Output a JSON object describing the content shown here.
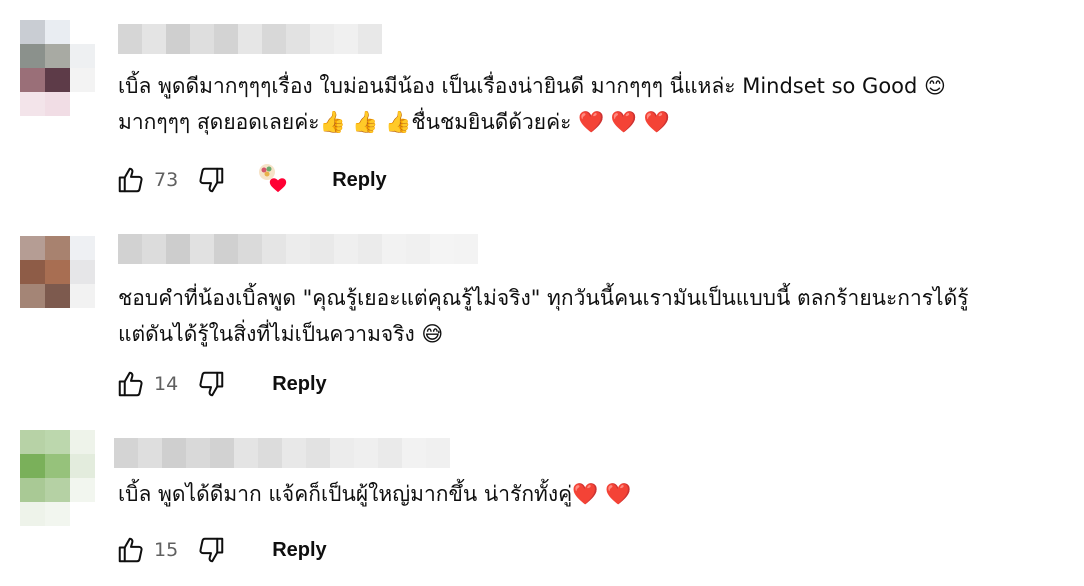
{
  "comments": [
    {
      "text_lines": [
        "เบิ้ล พูดดีมากๆๆๆเรื่อง ใบม่อนมีน้อง เป็นเรื่องน่ายินดี มากๆๆๆ นี่แหล่ะ Mindset so Good 😊",
        "มากๆๆๆ สุดยอดเลยค่ะ👍 👍 👍ชื่นชมยินดีด้วยค่ะ ❤️ ❤️ ❤️"
      ],
      "like_count": "73",
      "reply_label": "Reply",
      "creator_heart": true
    },
    {
      "text_lines": [
        "ชอบคำที่น้องเบิ้ลพูด \"คุณรู้เยอะแต่คุณรู้ไม่จริง\" ทุกวันนี้คนเรามันเป็นแบบนี้ ตลกร้ายนะการได้รู้",
        "แต่ดันได้รู้ในสิ่งที่ไม่เป็นความจริง 😅"
      ],
      "like_count": "14",
      "reply_label": "Reply",
      "creator_heart": false
    },
    {
      "text_lines": [
        "เบิ้ล พูดได้ดีมาก  แจ้คก็เป็นผู้ใหญ่มากขึ้น น่ารักทั้งคู่❤️ ❤️"
      ],
      "like_count": "15",
      "reply_label": "Reply",
      "creator_heart": false
    }
  ],
  "icons": {
    "like": "thumbs-up-icon",
    "dislike": "thumbs-down-icon",
    "heart": "creator-heart-icon"
  },
  "colors": {
    "text": "#0f0f0f",
    "secondary": "#606060",
    "heart": "#ff0033"
  }
}
